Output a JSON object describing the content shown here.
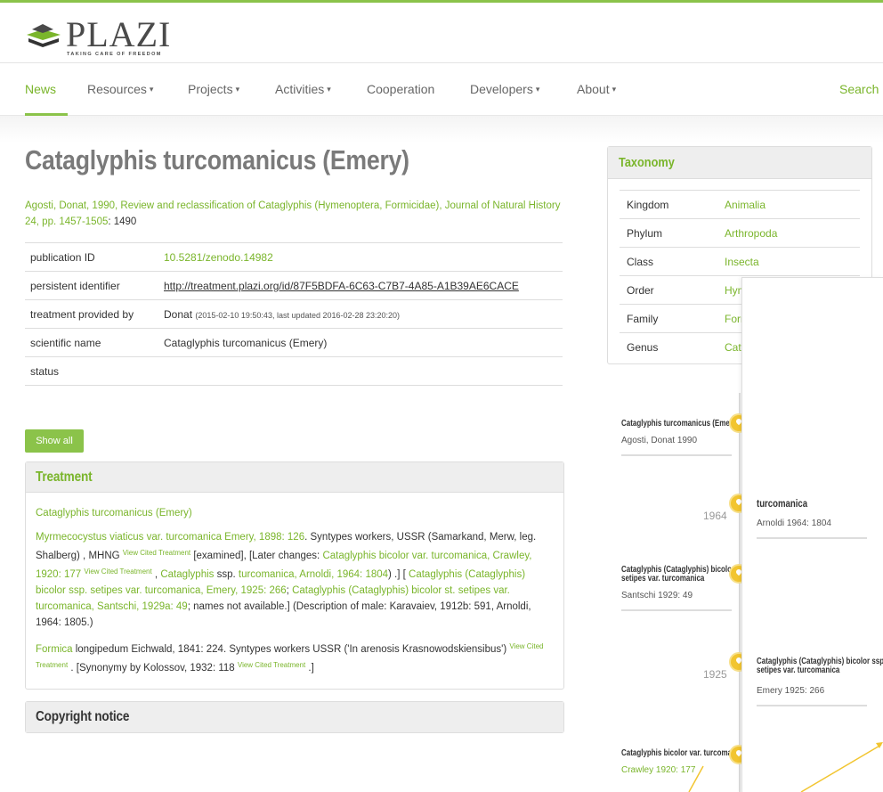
{
  "brand": {
    "name": "PLAZI",
    "tagline": "TAKING CARE OF FREEDOM"
  },
  "nav": {
    "items": [
      {
        "label": "News"
      },
      {
        "label": "Resources"
      },
      {
        "label": "Projects"
      },
      {
        "label": "Activities"
      },
      {
        "label": "Cooperation"
      },
      {
        "label": "Developers"
      },
      {
        "label": "About"
      }
    ],
    "search": "Search",
    "caret": "▾"
  },
  "page": {
    "title": "Cataglyphis turcomanicus (Emery)",
    "citation_link": "Agosti, Donat, 1990, Review and reclassification of Cataglyphis (Hymenoptera, Formicidae), Journal of Natural History 24, pp. 1457-1505",
    "citation_page": ": 1490"
  },
  "meta": {
    "rows": [
      {
        "key": "publication ID",
        "value": "10.5281/zenodo.14982"
      },
      {
        "key": "persistent identifier",
        "value": "http://treatment.plazi.org/id/87F5BDFA-6C63-C7B7-4A85-A1B39AE6CACE"
      },
      {
        "key": "treatment provided by",
        "value": "Donat",
        "note": "(2015-02-10 19:50:43, last updated 2016-02-28 23:20:20)"
      },
      {
        "key": "scientific name",
        "value": "Cataglyphis turcomanicus (Emery)"
      },
      {
        "key": "status",
        "value": ""
      }
    ]
  },
  "show_all": "Show all",
  "treatment": {
    "heading": "Treatment",
    "name": "Cataglyphis turcomanicus (Emery)",
    "vct": "View Cited Treatment",
    "p1": {
      "a": "Myrmecocystus viaticus var. turcomanica Emery, 1898: 126",
      "b": ". Syntypes workers, USSR (Samarkand, Merw, leg. Shalberg) , MHNG ",
      "c": " [examined], [Later changes: ",
      "d": "Cataglyphis bicolor var. turcomanica, Crawley, 1920: 177",
      "e": " , ",
      "f": "Cataglyphis",
      "g": " ssp. ",
      "h": "turcomanica, Arnoldi, 1964: 1804",
      "i": ") .] [ ",
      "j": "Cataglyphis (Cataglyphis) bicolor ssp. setipes var. turcomanica, Emery, 1925: 266",
      "k": "; ",
      "l": "Cataglyphis (Cataglyphis) bicolor st. setipes var. turcomanica, Santschi, 1929a: 49",
      "m": "; names not available.] (Description of male: Karavaiev, 1912b: 591, Arnoldi, 1964: 1805.)"
    },
    "p2": {
      "a": "Formica",
      "b": " longipedum Eichwald, 1841: 224. Syntypes workers USSR ('In arenosis Krasnowodskiensibus')",
      "c": " . [Synonymy by Kolossov, 1932: 118 ",
      "d": " .]"
    }
  },
  "copyright": {
    "heading": "Copyright notice"
  },
  "taxonomy": {
    "heading": "Taxonomy",
    "rows": [
      {
        "key": "Kingdom",
        "value": "Animalia"
      },
      {
        "key": "Phylum",
        "value": "Arthropoda"
      },
      {
        "key": "Class",
        "value": "Insecta"
      },
      {
        "key": "Order",
        "value": "Hymenoptera"
      },
      {
        "key": "Family",
        "value": "Formicidae"
      },
      {
        "key": "Genus",
        "value": "Cataglyphis"
      }
    ]
  },
  "timeline": {
    "events": [
      {
        "year": "1990",
        "name": "Cataglyphis turcomanicus (Emery)",
        "author": "Agosti, Donat 1990"
      },
      {
        "year": "1964",
        "name": "turcomanica",
        "author": "Arnoldi 1964: 1804"
      },
      {
        "year": "1929",
        "name": "Cataglyphis (Cataglyphis) bicolor st. setipes var. turcomanica",
        "author": "Santschi 1929: 49"
      },
      {
        "year": "1925",
        "name": "Cataglyphis (Cataglyphis) bicolor ssp. setipes var. turcomanica",
        "author": "Emery 1925: 266"
      },
      {
        "year": "1920",
        "name": "Cataglyphis bicolor var. turcomanica",
        "author": "Crawley 1920: 177"
      }
    ]
  },
  "colors": {
    "accent": "#7ab52b",
    "pin": "#f2c530",
    "arrow": "#f2c530"
  },
  "icons": [
    "plazi-logo-icon",
    "caret-down-icon",
    "map-pin-icon",
    "arrow-icon"
  ]
}
